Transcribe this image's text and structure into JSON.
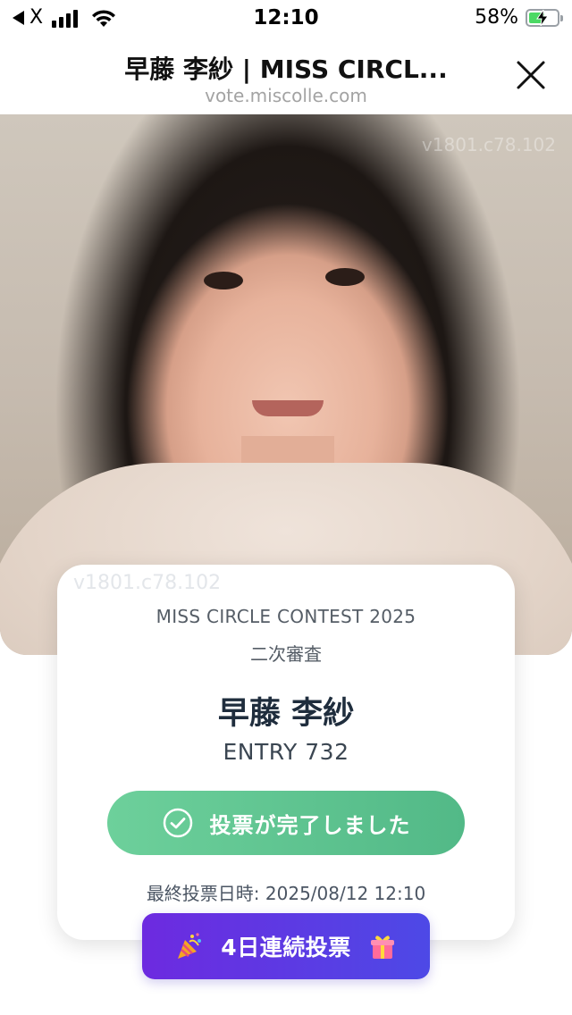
{
  "status_bar": {
    "carrier": "X",
    "time": "12:10",
    "battery_percent": "58%",
    "battery_level": 0.58
  },
  "nav": {
    "title": "早藤 李紗 | MISS CIRCL...",
    "url": "vote.miscolle.com"
  },
  "photo": {
    "watermark": "v1801.c78.102"
  },
  "card": {
    "watermark": "v1801.c78.102",
    "contest": "MISS CIRCLE CONTEST 2025",
    "stage": "二次審査",
    "name": "早藤 李紗",
    "entry": "ENTRY 732",
    "vote_button_label": "投票が完了しました",
    "last_vote": "最終投票日時: 2025/08/12 12:10"
  },
  "streak": {
    "label": "4日連続投票"
  },
  "colors": {
    "vote_green": "#5cc38f",
    "streak_purple": "#6d2ae0",
    "streak_indigo": "#4d49e6"
  },
  "icons": [
    "back-arrow-icon",
    "cellular-signal-icon",
    "wifi-icon",
    "battery-charging-icon",
    "close-icon",
    "check-circle-icon",
    "party-popper-icon",
    "gift-box-icon"
  ]
}
